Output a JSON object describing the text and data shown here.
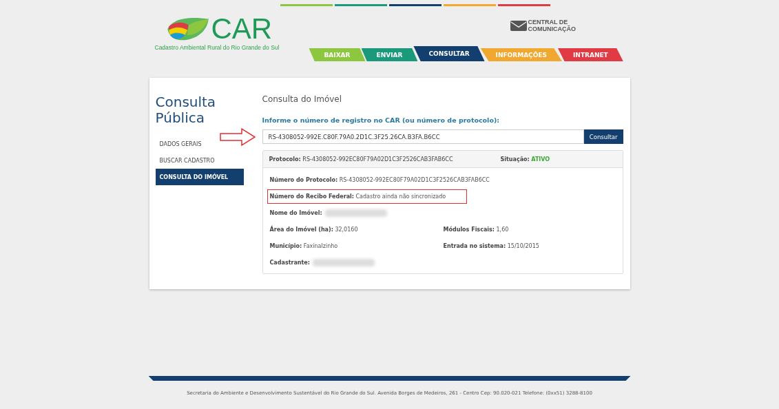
{
  "header": {
    "logo_text": "CAR",
    "logo_subtitle": "Cadastro Ambiental Rural do Rio Grande do Sul",
    "communication_link": [
      "CENTRAL DE",
      "COMUNICAÇÃO"
    ],
    "top_lines": [
      {
        "color": "#8dc63f"
      },
      {
        "color": "#1a9a7a"
      },
      {
        "color": "#123f6e"
      },
      {
        "color": "#f0a830"
      },
      {
        "color": "#e03a45"
      }
    ],
    "tabs": [
      {
        "label": "BAIXAR",
        "color": "#8dc63f",
        "selected": false
      },
      {
        "label": "ENVIAR",
        "color": "#1a9a7a",
        "selected": false
      },
      {
        "label": "CONSULTAR",
        "color": "#123f6e",
        "selected": true
      },
      {
        "label": "INFORMAÇÕES",
        "color": "#f0a830",
        "selected": false
      },
      {
        "label": "INTRANET",
        "color": "#e03a45",
        "selected": false
      }
    ]
  },
  "sidebar": {
    "title": [
      "Consulta",
      "Pública"
    ],
    "items": [
      {
        "label": "DADOS GERAIS",
        "selected": false
      },
      {
        "label": "BUSCAR CADASTRO",
        "selected": false
      },
      {
        "label": "CONSULTA DO IMÓVEL",
        "selected": true
      }
    ]
  },
  "main": {
    "heading": "Consulta do Imóvel",
    "prompt": "Informe o número de registro no CAR (ou número de protocolo):",
    "search_value": "RS-4308052-992E.C80F.79A0.2D1C.3F25.26CA.B3FA.B6CC",
    "search_button": "Consultar",
    "result": {
      "protocol_label": "Protocolo:",
      "protocol_value": "RS-4308052-992EC80F79A02D1C3F2526CAB3FAB6CC",
      "status_label": "Situação:",
      "status_value": "ATIVO",
      "rows": [
        [
          {
            "label": "Número do Protocolo:",
            "value": "RS-4308052-992EC80F79A02D1C3F2526CAB3FAB6CC",
            "redacted": false,
            "highlighted": false
          }
        ],
        [
          {
            "label": "Número do Recibo Federal:",
            "value": "Cadastro ainda não sincronizado",
            "redacted": false,
            "highlighted": true
          }
        ],
        [
          {
            "label": "Nome do Imóvel:",
            "redacted": true,
            "highlighted": false
          }
        ],
        [
          {
            "label": "Área do Imóvel (ha):",
            "value": "32,0160",
            "redacted": false,
            "highlighted": false
          },
          {
            "label": "Módulos Fiscais:",
            "value": "1,60",
            "redacted": false,
            "highlighted": false
          }
        ],
        [
          {
            "label": "Município:",
            "value": "Faxinalzinho",
            "redacted": false,
            "highlighted": false
          },
          {
            "label": "Entrada no sistema:",
            "value": "15/10/2015",
            "redacted": false,
            "highlighted": false
          }
        ],
        [
          {
            "label": "Cadastrante:",
            "redacted": true,
            "highlighted": false
          }
        ]
      ]
    }
  },
  "footer": "Secretaria do Ambiente e Desenvolvimento Sustentável do Rio Grande do Sul. Avenida Borges de Medeiros, 261 - Centro Cep: 90.020-021 Telefone: (0xx51) 3288-8100"
}
